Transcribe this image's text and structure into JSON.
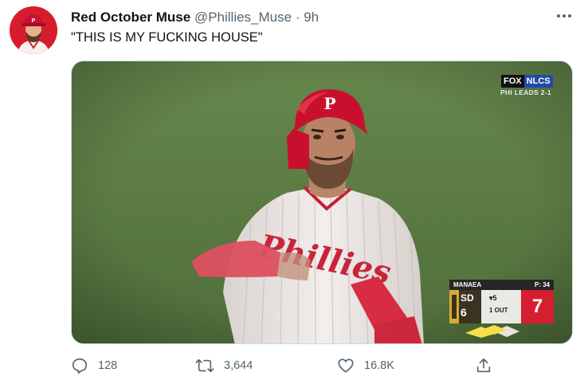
{
  "tweet": {
    "author_name": "Red October Muse",
    "author_handle": "@Phillies_Muse",
    "separator": "·",
    "time": "9h",
    "text": "\"THIS IS MY FUCKING HOUSE\"",
    "avatar_icon": "phillies-player-avatar-icon",
    "more_icon": "more-options-icon"
  },
  "media": {
    "broadcast_network": "FOX",
    "broadcast_series": "NLCS",
    "series_status": "PHI LEADS 2-1",
    "scorebug": {
      "pitcher": "MANAEA",
      "pitch_count": "P: 34",
      "away_team": "SD",
      "away_score": "6",
      "inning": "▾5",
      "outs": "1 OUT",
      "home_score": "7",
      "home_color": "#d31f2f"
    },
    "jersey_text": "Phillies"
  },
  "actions": {
    "reply_count": "128",
    "retweet_count": "3,644",
    "like_count": "16.8K",
    "reply_icon": "reply-icon",
    "retweet_icon": "retweet-icon",
    "like_icon": "like-icon",
    "share_icon": "share-icon"
  },
  "colors": {
    "text_primary": "#0f1419",
    "text_secondary": "#536471",
    "field_green": "#5d7c45",
    "phillies_red": "#d71d2d"
  }
}
